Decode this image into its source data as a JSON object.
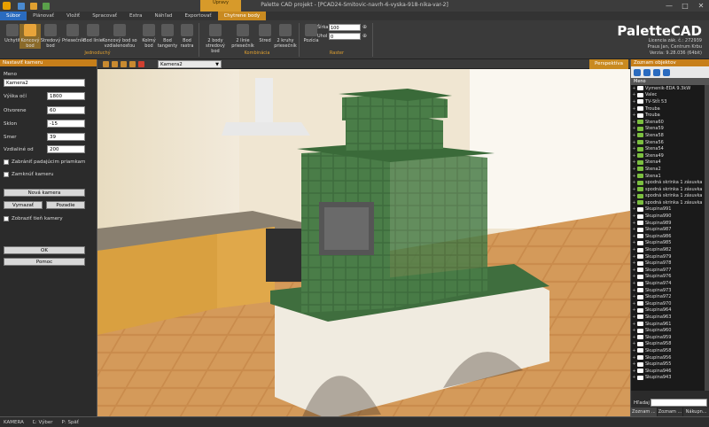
{
  "window": {
    "title": "Palette CAD projekt - [PCAD24-Smitovic-navrh-6-vyska-918-nika-var-2]",
    "context_header": "Úpravy",
    "buttons": [
      "—",
      "□",
      "✕"
    ]
  },
  "tabs": [
    {
      "label": "Súbor",
      "kind": "file"
    },
    {
      "label": "Plánovať",
      "kind": "normal"
    },
    {
      "label": "Vložiť",
      "kind": "normal"
    },
    {
      "label": "Spracovať",
      "kind": "normal"
    },
    {
      "label": "Extra",
      "kind": "normal"
    },
    {
      "label": "Náhľad",
      "kind": "normal"
    },
    {
      "label": "Exportovať",
      "kind": "normal"
    },
    {
      "label": "Chytrene body",
      "kind": "ctx"
    }
  ],
  "ribbon": {
    "jednoduchy": {
      "group_label": "Jednoduchý",
      "buttons": [
        {
          "label": "Uchytiť",
          "icon": "pin-icon"
        },
        {
          "label": "Koncový bod",
          "icon": "endpoint-icon",
          "selected": true
        },
        {
          "label": "Stredový bod",
          "icon": "midpoint-icon"
        },
        {
          "label": "Priesečník",
          "icon": "intersection-icon"
        },
        {
          "label": "Bod línie",
          "icon": "line-point-icon"
        },
        {
          "label": "Koncový bod so vzdialenosťou",
          "icon": "endpoint-distance-icon"
        },
        {
          "label": "Kolmý bod",
          "icon": "perpendicular-icon"
        },
        {
          "label": "Bod tangenty",
          "icon": "tangent-icon"
        },
        {
          "label": "Bod rastra",
          "icon": "grid-point-icon"
        }
      ]
    },
    "kombinacia": {
      "group_label": "Kombinácia",
      "buttons": [
        {
          "label": "2 body stredový bod",
          "icon": "two-points-icon"
        },
        {
          "label": "2 línie priesečník",
          "icon": "two-lines-icon"
        },
        {
          "label": "Stred",
          "icon": "center-icon"
        },
        {
          "label": "2 kruhy priesečník",
          "icon": "two-circles-icon"
        }
      ]
    },
    "raster": {
      "group_label": "Raster",
      "button": {
        "label": "Pozícia",
        "icon": "grid-icon"
      },
      "sirka_label": "Šírka",
      "sirka_value": "100",
      "uhol_label": "Uhol",
      "uhol_value": "0"
    },
    "brand": {
      "name": "PaletteCAD",
      "lines": [
        "Licencia zák. č.: 272939",
        "Praus Jan, Centrum Krbu",
        "Verzia: 9.28.036 (64bit)"
      ]
    }
  },
  "left_panel": {
    "title": "Nastaviť kameru",
    "meno_label": "Meno",
    "meno_value": "Kamera2",
    "fields": [
      {
        "label": "Výška očí",
        "value": "1800"
      },
      {
        "label": "Otvorene",
        "value": "60"
      },
      {
        "label": "Sklon",
        "value": "-15"
      },
      {
        "label": "Smer",
        "value": "39"
      },
      {
        "label": "Vzdialiné od",
        "value": "200"
      }
    ],
    "checks": [
      "Zabrániť padajúcim priamkam",
      "Zamknúť kameru"
    ],
    "btn_new": "Nová kamera",
    "btn_remove": "Vymazať",
    "btn_back": "Pozadie",
    "check_show": "Zobraziť tieň kamery",
    "btn_ok": "OK",
    "btn_help": "Pomoc"
  },
  "viewport": {
    "camera_value": "Kamera2",
    "mode": "Perspektíva"
  },
  "right_panel": {
    "title": "Zoznam objektov",
    "head": "Meno",
    "items": [
      {
        "name": "Vymenik-EDA 9.3kW",
        "color": "white"
      },
      {
        "name": "Valec",
        "color": "white"
      },
      {
        "name": "TV-Stĺt 53",
        "color": "white"
      },
      {
        "name": "Trouba",
        "color": "white"
      },
      {
        "name": "Trouba",
        "color": "white"
      },
      {
        "name": "Stena60",
        "color": "green"
      },
      {
        "name": "Stena59",
        "color": "green"
      },
      {
        "name": "Stena58",
        "color": "green"
      },
      {
        "name": "Stena56",
        "color": "green"
      },
      {
        "name": "Stena54",
        "color": "green"
      },
      {
        "name": "Stena49",
        "color": "green"
      },
      {
        "name": "Stena4",
        "color": "green"
      },
      {
        "name": "Stena2",
        "color": "green"
      },
      {
        "name": "Stena1",
        "color": "green"
      },
      {
        "name": "spodná skrinka 1 zásuvka",
        "color": "green"
      },
      {
        "name": "spodná skrinka 1 zásuvka",
        "color": "green"
      },
      {
        "name": "spodná skrinka 1 zásuvka",
        "color": "green"
      },
      {
        "name": "spodná skrinka 1 zásuvka",
        "color": "green"
      },
      {
        "name": "Skupina991",
        "color": "white"
      },
      {
        "name": "Skupina990",
        "color": "white"
      },
      {
        "name": "Skupina989",
        "color": "white"
      },
      {
        "name": "Skupina987",
        "color": "white"
      },
      {
        "name": "Skupina986",
        "color": "white"
      },
      {
        "name": "Skupina985",
        "color": "white"
      },
      {
        "name": "Skupina982",
        "color": "white"
      },
      {
        "name": "Skupina979",
        "color": "white"
      },
      {
        "name": "Skupina978",
        "color": "white"
      },
      {
        "name": "Skupina977",
        "color": "white"
      },
      {
        "name": "Skupina976",
        "color": "white"
      },
      {
        "name": "Skupina974",
        "color": "white"
      },
      {
        "name": "Skupina973",
        "color": "white"
      },
      {
        "name": "Skupina972",
        "color": "white"
      },
      {
        "name": "Skupina970",
        "color": "white"
      },
      {
        "name": "Skupina964",
        "color": "white"
      },
      {
        "name": "Skupina963",
        "color": "white"
      },
      {
        "name": "Skupina961",
        "color": "white"
      },
      {
        "name": "Skupina960",
        "color": "white"
      },
      {
        "name": "Skupina959",
        "color": "white"
      },
      {
        "name": "Skupina958",
        "color": "white"
      },
      {
        "name": "Skupina958",
        "color": "white"
      },
      {
        "name": "Skupina956",
        "color": "white"
      },
      {
        "name": "Skupina955",
        "color": "white"
      },
      {
        "name": "Skupina946",
        "color": "white"
      },
      {
        "name": "Skupina943",
        "color": "white"
      }
    ],
    "search_label": "Hľadaj",
    "tabs": [
      "Zoznam ...",
      "Zoznam ...",
      "Nákupn..."
    ]
  },
  "status": {
    "mode": "KAMERA",
    "left": "Ľ: Výber",
    "right": "P: Späť"
  }
}
